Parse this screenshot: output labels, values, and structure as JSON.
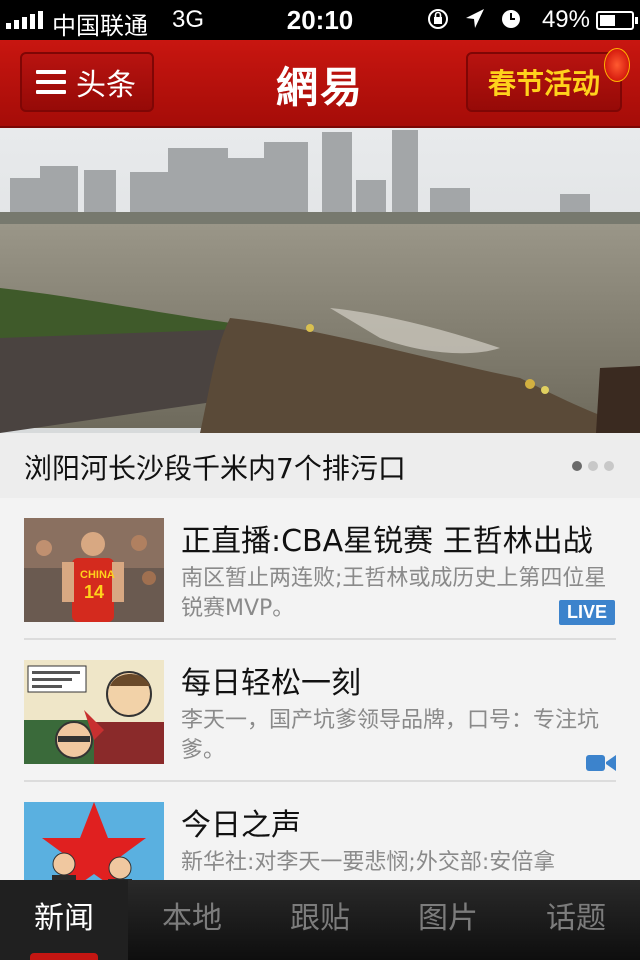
{
  "status_bar": {
    "carrier": "中国联通",
    "network": "3G",
    "time": "20:10",
    "battery_percent": "49%",
    "battery_level": 0.49,
    "icons": [
      "rotation-lock-icon",
      "location-icon",
      "alarm-icon"
    ]
  },
  "navbar": {
    "menu_label": "头条",
    "logo": "網易",
    "event_label": "春节活动",
    "colors": {
      "bar": "#b8120e",
      "event_text": "#ffd21c"
    }
  },
  "hero": {
    "caption": "浏阳河长沙段千米内7个排污口",
    "page_count": 3,
    "current_page": 1
  },
  "news": [
    {
      "title": "正直播:CBA星锐赛 王哲林出战",
      "desc": "南区暂止两连败;王哲林或成历史上第四位星锐赛MVP。",
      "badge": "LIVE",
      "thumb": "basketball-player-photo"
    },
    {
      "title": "每日轻松一刻",
      "desc": "李天一，国产坑爹领导品牌，口号：专注坑爹。",
      "badge_icon": "video-camera-icon",
      "thumb": "cartoon-comic-photo"
    },
    {
      "title": "今日之声",
      "desc": "新华社:对李天一要悲悯;外交部:安倍拿",
      "thumb": "red-star-poster-photo"
    }
  ],
  "tabbar": {
    "tabs": [
      "新闻",
      "本地",
      "跟贴",
      "图片",
      "话题"
    ],
    "active": 0,
    "active_color": "#c41612"
  }
}
